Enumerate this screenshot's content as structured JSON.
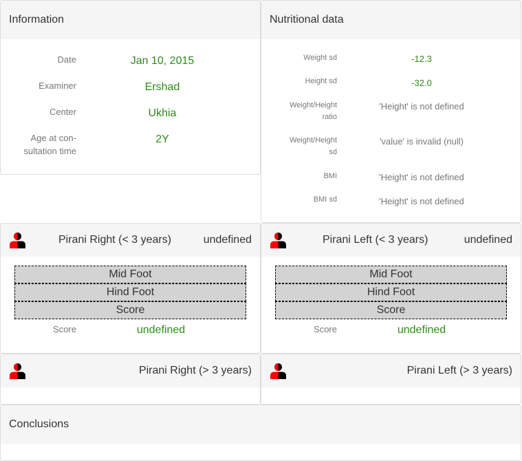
{
  "information": {
    "title": "Information",
    "rows": [
      {
        "label": "Date",
        "value": "Jan 10, 2015"
      },
      {
        "label": "Examiner",
        "value": "Ershad"
      },
      {
        "label": "Center",
        "value": "Ukhia"
      },
      {
        "label_line1": "Age at con-",
        "label_line2": "sultation time",
        "value": "2Y"
      }
    ]
  },
  "nutrition": {
    "title": "Nutritional data",
    "rows": [
      {
        "label_line1": "Weight sd",
        "value": "-12.3"
      },
      {
        "label_line1": "Height sd",
        "value": "-32.0"
      },
      {
        "label_line1": "Weight/Height",
        "label_line2": "ratio",
        "value": "'Height' is not defined"
      },
      {
        "label_line1": "Weight/Height",
        "label_line2": "sd",
        "value": "'value' is invalid (null)"
      },
      {
        "label_line1": "BMI",
        "value": "'Height' is not defined"
      },
      {
        "label_line1": "BMI sd",
        "value": "'Height' is not defined"
      }
    ]
  },
  "pirani_right_lt3": {
    "title": "Pirani Right (< 3 years)",
    "status": "undefined",
    "boxes": [
      "Mid Foot",
      "Hind Foot",
      "Score"
    ],
    "score_label": "Score",
    "score_value": "undefined"
  },
  "pirani_left_lt3": {
    "title": "Pirani Left (< 3 years)",
    "status": "undefined",
    "boxes": [
      "Mid Foot",
      "Hind Foot",
      "Score"
    ],
    "score_label": "Score",
    "score_value": "undefined"
  },
  "pirani_right_gt3": {
    "title": "Pirani Right (> 3 years)"
  },
  "pirani_left_gt3": {
    "title": "Pirani Left (> 3 years)"
  },
  "conclusions": {
    "title": "Conclusions"
  },
  "colors": {
    "value_green": "#2e8b18",
    "label_gray": "#777777",
    "header_bg": "#f5f5f5",
    "icon_red": "#ff0000",
    "icon_black": "#000000"
  },
  "icons": {
    "patient": "person-half-red-icon"
  }
}
